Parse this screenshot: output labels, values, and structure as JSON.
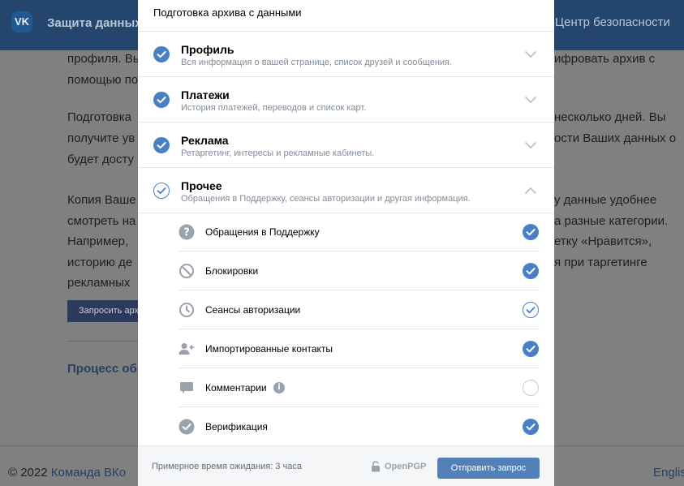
{
  "background": {
    "header": {
      "logo": "VK",
      "title": "Защита данных",
      "right_title": "Центр безопасности"
    },
    "left_lines": [
      "профиля. Вы",
      "помощью по",
      "Подготовка",
      "получите ув",
      "будет досту",
      "Копия Ваше",
      "смотреть на",
      "Например,",
      "историю де",
      "рекламных"
    ],
    "right_lines": [
      "ифровать архив с",
      "несколько дней. Вы",
      "ости Ваших данных о",
      "у данные удобнее",
      "а разные категории.",
      "етку «Нравится»,",
      "я при таргетинге"
    ],
    "request_button": "Запросить архив",
    "process_link": "Процесс обр",
    "footer": {
      "copyright": "© 2022 ",
      "company": "Команда ВКо",
      "lang": "Englis"
    }
  },
  "modal": {
    "title": "Подготовка архива с данными",
    "sections": [
      {
        "title": "Профиль",
        "subtitle": "Вся информация о вашей странице, список друзей и сообщения.",
        "state": "checked",
        "expanded": false
      },
      {
        "title": "Платежи",
        "subtitle": "История платежей, переводов и список карт.",
        "state": "checked",
        "expanded": false
      },
      {
        "title": "Реклама",
        "subtitle": "Ретаргетинг, интересы и рекламные кабинеты.",
        "state": "checked",
        "expanded": false
      },
      {
        "title": "Прочее",
        "subtitle": "Обращения в Поддержку, сеансы авторизации и другая информация.",
        "state": "partial",
        "expanded": true
      }
    ],
    "subitems": [
      {
        "label": "Обращения в Поддержку",
        "icon": "question-icon",
        "state": "checked"
      },
      {
        "label": "Блокировки",
        "icon": "block-icon",
        "state": "checked"
      },
      {
        "label": "Сеансы авторизации",
        "icon": "clock-icon",
        "state": "partial"
      },
      {
        "label": "Импортированные контакты",
        "icon": "user-import-icon",
        "state": "checked"
      },
      {
        "label": "Комментарии",
        "icon": "comment-icon",
        "state": "empty",
        "info": "i"
      },
      {
        "label": "Верификация",
        "icon": "verified-icon",
        "state": "checked"
      }
    ],
    "footer": {
      "wait_text": "Примерное время ожидания: 3 часа",
      "openpgp_label": "OpenPGP",
      "submit_label": "Отправить запрос"
    }
  },
  "colors": {
    "accent": "#4a80c4",
    "button": "#5181b8",
    "header_bg": "#24466e",
    "overlay": "#808080"
  }
}
